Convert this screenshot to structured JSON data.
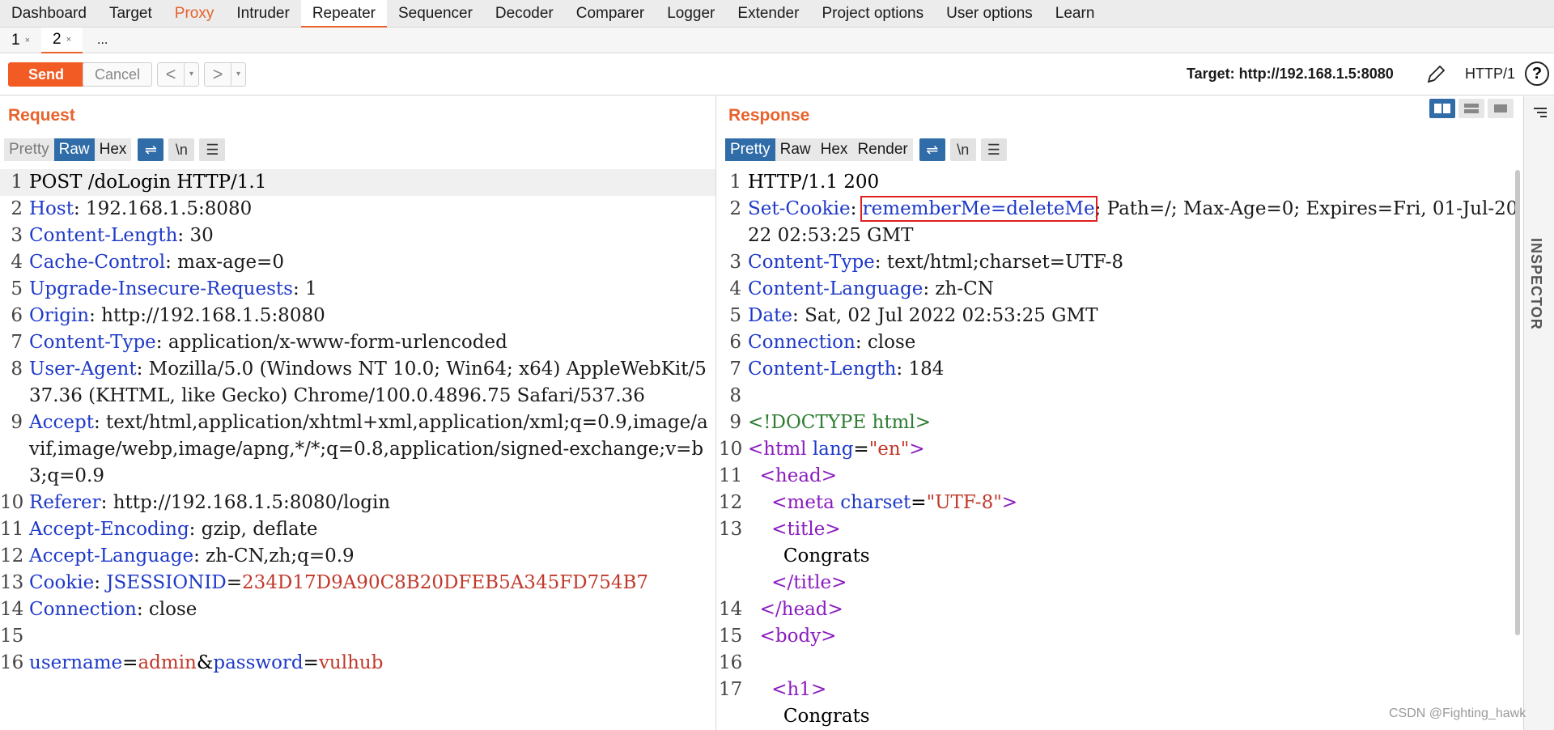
{
  "menu": [
    "Dashboard",
    "Target",
    "Proxy",
    "Intruder",
    "Repeater",
    "Sequencer",
    "Decoder",
    "Comparer",
    "Logger",
    "Extender",
    "Project options",
    "User options",
    "Learn"
  ],
  "subtabs": [
    {
      "label": "1",
      "close": "×"
    },
    {
      "label": "2",
      "close": "×"
    },
    {
      "label": "..."
    }
  ],
  "toolbar": {
    "send": "Send",
    "cancel": "Cancel",
    "back": "<",
    "forward": ">",
    "dropdown": "▾",
    "target": "Target: http://192.168.1.5:8080",
    "http_version": "HTTP/1",
    "help": "?"
  },
  "request": {
    "title": "Request",
    "view_tabs": [
      "Pretty",
      "Raw",
      "Hex"
    ],
    "icons": {
      "wrap": "⇌",
      "newline": "\\n",
      "menu": "☰"
    },
    "lines": [
      {
        "n": "1",
        "text": "POST /doLogin HTTP/1.1"
      },
      {
        "n": "2",
        "key": "Host",
        "val": ": 192.168.1.5:8080"
      },
      {
        "n": "3",
        "key": "Content-Length",
        "val": ": 30"
      },
      {
        "n": "4",
        "key": "Cache-Control",
        "val": ": max-age=0"
      },
      {
        "n": "5",
        "key": "Upgrade-Insecure-Requests",
        "val": ": 1"
      },
      {
        "n": "6",
        "key": "Origin",
        "val": ": http://192.168.1.5:8080"
      },
      {
        "n": "7",
        "key": "Content-Type",
        "val": ": application/x-www-form-urlencoded"
      },
      {
        "n": "8",
        "key": "User-Agent",
        "val": ": Mozilla/5.0 (Windows NT 10.0; Win64; x64) AppleWebKit/537.36 (KHTML, like Gecko) Chrome/100.0.4896.75 Safari/537.36"
      },
      {
        "n": "9",
        "key": "Accept",
        "val": ": text/html,application/xhtml+xml,application/xml;q=0.9,image/avif,image/webp,image/apng,*/*;q=0.8,application/signed-exchange;v=b3;q=0.9"
      },
      {
        "n": "10",
        "key": "Referer",
        "val": ": http://192.168.1.5:8080/login"
      },
      {
        "n": "11",
        "key": "Accept-Encoding",
        "val": ": gzip, deflate"
      },
      {
        "n": "12",
        "key": "Accept-Language",
        "val": ": zh-CN,zh;q=0.9"
      },
      {
        "n": "13",
        "key": "Cookie",
        "val": ": ",
        "cookie_name": "JSESSIONID",
        "cookie_eq": "=",
        "cookie_val": "234D17D9A90C8B20DFEB5A345FD754B7"
      },
      {
        "n": "14",
        "key": "Connection",
        "val": ": close"
      },
      {
        "n": "15",
        "text": ""
      },
      {
        "n": "16",
        "p1": "username",
        "v1": "admin",
        "p2": "password",
        "v2": "vulhub"
      }
    ]
  },
  "response": {
    "title": "Response",
    "view_tabs": [
      "Pretty",
      "Raw",
      "Hex",
      "Render"
    ],
    "icons": {
      "wrap": "⇌",
      "newline": "\\n",
      "menu": "☰"
    },
    "lines": {
      "l1": {
        "n": "1",
        "text": "HTTP/1.1 200"
      },
      "l2": {
        "n": "2",
        "key": "Set-Cookie",
        "colon": ": ",
        "boxed": "rememberMe=deleteMe",
        "rest": "; Path=/; Max-Age=0; Expires=Fri, 01-Jul-2022 02:53:25 GMT"
      },
      "l3": {
        "n": "3",
        "key": "Content-Type",
        "val": ": text/html;charset=UTF-8"
      },
      "l4": {
        "n": "4",
        "key": "Content-Language",
        "val": ": zh-CN"
      },
      "l5": {
        "n": "5",
        "key": "Date",
        "val": ": Sat, 02 Jul 2022 02:53:25 GMT"
      },
      "l6": {
        "n": "6",
        "key": "Connection",
        "val": ": close"
      },
      "l7": {
        "n": "7",
        "key": "Content-Length",
        "val": ": 184"
      },
      "l8": {
        "n": "8"
      },
      "l9": {
        "n": "9",
        "text": "<!DOCTYPE html>"
      },
      "l10": {
        "n": "10",
        "open": "<html ",
        "attr": "lang",
        "eq": "=",
        "val": "\"en\"",
        "close": ">"
      },
      "l11": {
        "n": "11",
        "text": "  <head>"
      },
      "l12": {
        "n": "12",
        "open": "    <meta ",
        "attr": "charset",
        "eq": "=",
        "val": "\"UTF-8\"",
        "close": ">"
      },
      "l13": {
        "n": "13",
        "text": "    <title>"
      },
      "l13b": {
        "text": "      Congrats"
      },
      "l13c": {
        "text": "    </title>"
      },
      "l14": {
        "n": "14",
        "text": "  </head>"
      },
      "l15": {
        "n": "15",
        "text": "  <body>"
      },
      "l16": {
        "n": "16",
        "text": ""
      },
      "l17": {
        "n": "17",
        "text": "    <h1>"
      },
      "l17b": {
        "text": "      Congrats"
      }
    }
  },
  "inspector": {
    "label": "INSPECTOR"
  },
  "watermark": "CSDN @Fighting_hawk"
}
